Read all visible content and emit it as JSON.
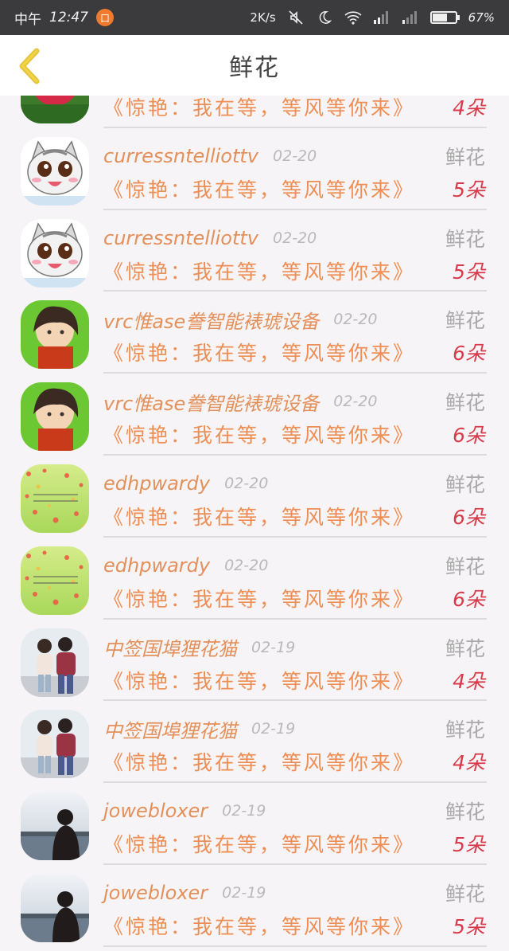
{
  "status_bar": {
    "period": "中午",
    "time": "12:47",
    "app_badge": "口",
    "network_speed": "2K/s",
    "battery": "67%",
    "battery_level": 0.67
  },
  "header": {
    "title": "鲜花"
  },
  "rows": [
    {
      "name": "",
      "date": "",
      "gift": "",
      "book": "《惊艳：我在等，等风等你来》",
      "count": "4朵",
      "avatar": "rose"
    },
    {
      "name": "curressntelliottv",
      "date": "02-20",
      "gift": "鲜花",
      "book": "《惊艳：我在等，等风等你来》",
      "count": "5朵",
      "avatar": "cat"
    },
    {
      "name": "curressntelliottv",
      "date": "02-20",
      "gift": "鲜花",
      "book": "《惊艳：我在等，等风等你来》",
      "count": "5朵",
      "avatar": "cat"
    },
    {
      "name": "vrc惟ase誊智能裱琥设备",
      "date": "02-20",
      "gift": "鲜花",
      "book": "《惊艳：我在等，等风等你来》",
      "count": "6朵",
      "avatar": "anime"
    },
    {
      "name": "vrc惟ase誊智能裱琥设备",
      "date": "02-20",
      "gift": "鲜花",
      "book": "《惊艳：我在等，等风等你来》",
      "count": "6朵",
      "avatar": "anime"
    },
    {
      "name": "edhpwardy",
      "date": "02-20",
      "gift": "鲜花",
      "book": "《惊艳：我在等，等风等你来》",
      "count": "6朵",
      "avatar": "dots"
    },
    {
      "name": "edhpwardy",
      "date": "02-20",
      "gift": "鲜花",
      "book": "《惊艳：我在等，等风等你来》",
      "count": "6朵",
      "avatar": "dots"
    },
    {
      "name": "中签国埠狸花猫",
      "date": "02-19",
      "gift": "鲜花",
      "book": "《惊艳：我在等，等风等你来》",
      "count": "4朵",
      "avatar": "couple"
    },
    {
      "name": "中签国埠狸花猫",
      "date": "02-19",
      "gift": "鲜花",
      "book": "《惊艳：我在等，等风等你来》",
      "count": "4朵",
      "avatar": "couple"
    },
    {
      "name": "jowebloxer",
      "date": "02-19",
      "gift": "鲜花",
      "book": "《惊艳：我在等，等风等你来》",
      "count": "5朵",
      "avatar": "lake"
    },
    {
      "name": "jowebloxer",
      "date": "02-19",
      "gift": "鲜花",
      "book": "《惊艳：我在等，等风等你来》",
      "count": "5朵",
      "avatar": "lake"
    }
  ]
}
